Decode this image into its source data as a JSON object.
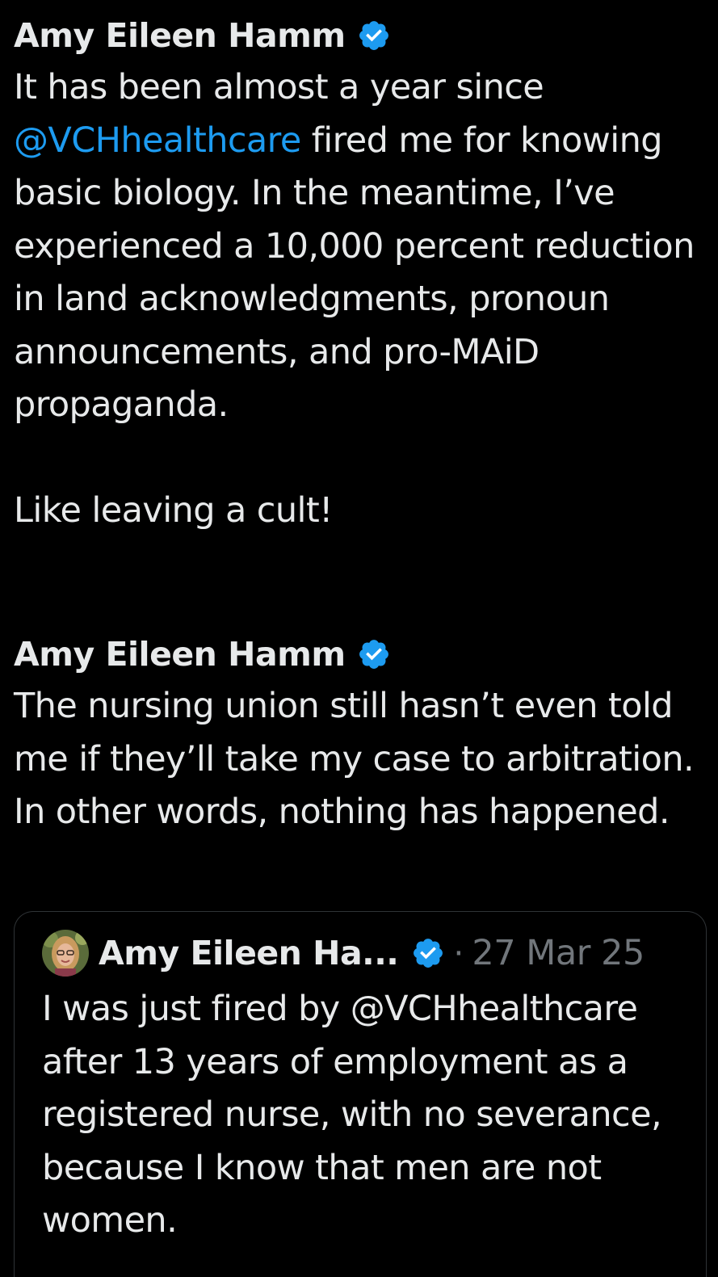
{
  "colors": {
    "background": "#000000",
    "text": "#e7e9ea",
    "mention": "#1d9bf0",
    "muted": "#71767b",
    "verified_badge": "#1d9bf0",
    "border": "#2f3336"
  },
  "tweets": [
    {
      "author": "Amy Eileen Hamm",
      "verified_icon": "verified-badge-icon",
      "text_before": "It has been almost a year since ",
      "mention": "@VCHhealthcare",
      "text_after": " fired me for knowing basic biology. In the meantime, I’ve experienced a 10,000 percent reduction in land acknowledgments, pronoun announcements, and pro-MAiD propaganda.\n\nLike leaving a cult!"
    },
    {
      "author": "Amy Eileen Hamm",
      "verified_icon": "verified-badge-icon",
      "text": "The nursing union still hasn’t even told me if they’ll take my case to arbitration. In other words, nothing has happened."
    }
  ],
  "quoted_tweet": {
    "author": "Amy Eileen Ha...",
    "avatar_icon": "profile-photo",
    "verified_icon": "verified-badge-icon",
    "separator": "·",
    "date": "27 Mar 25",
    "text": "I was just fired by @VCHhealthcare after 13 years of employment as a registered nurse, with no severance, because I know that men are not women."
  }
}
